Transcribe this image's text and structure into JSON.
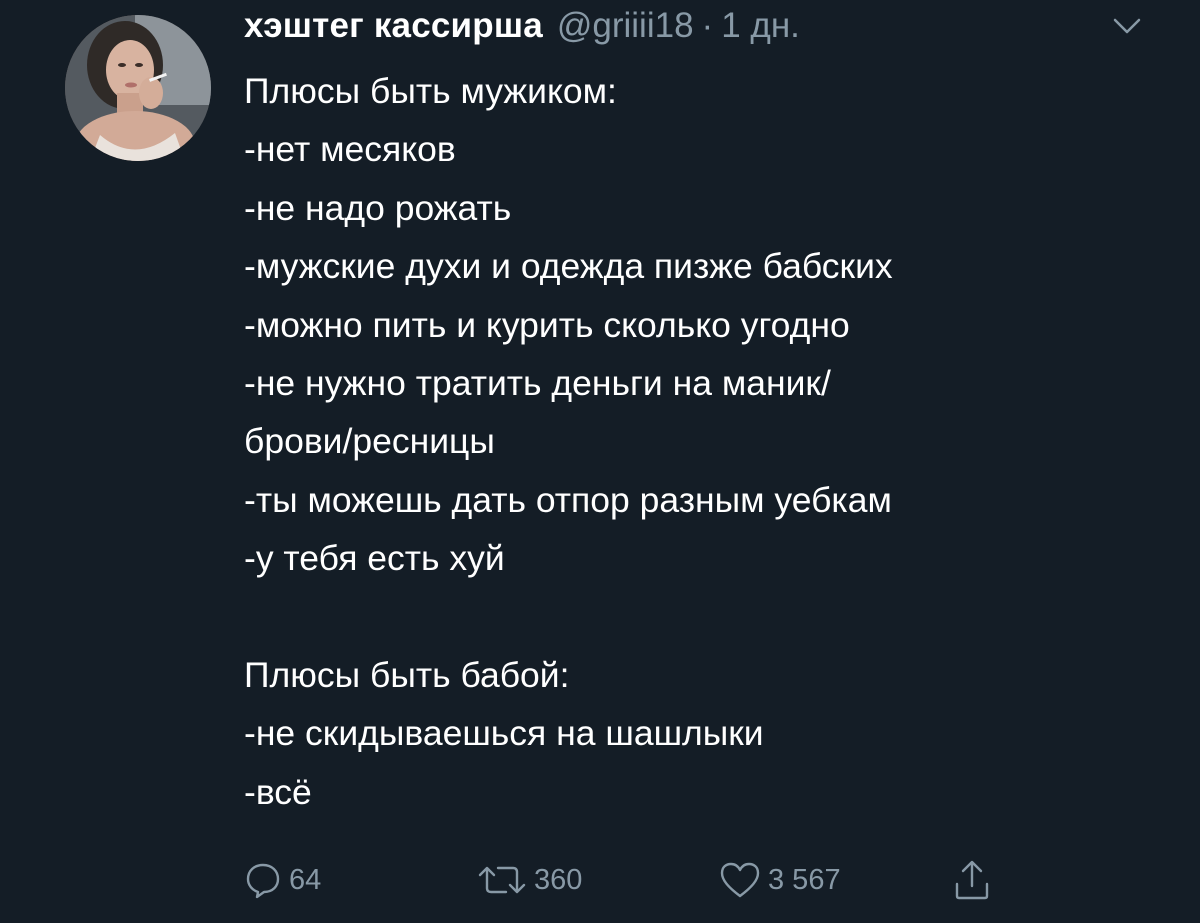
{
  "tweet": {
    "display_name": "хэштег кассирша",
    "handle": "@griiii18",
    "separator": "·",
    "time": "1 дн.",
    "lines": [
      "Плюсы быть мужиком:",
      "-нет месяков",
      "-не надо рожать",
      "-мужские духи и одежда пизже бабских",
      "-можно пить и курить сколько угодно",
      "-не нужно тратить деньги на маник/",
      "брови/ресницы",
      "-ты можешь дать отпор разным уебкам",
      "-у тебя есть хуй",
      "",
      "Плюсы быть бабой:",
      "-не скидываешься на шашлыки",
      "-всё"
    ]
  },
  "actions": {
    "reply": {
      "icon": "reply-icon",
      "count": "64"
    },
    "retweet": {
      "icon": "retweet-icon",
      "count": "360"
    },
    "like": {
      "icon": "heart-icon",
      "count": "3 567"
    },
    "share": {
      "icon": "share-icon"
    }
  },
  "menu": {
    "icon": "chevron-down-icon"
  },
  "colors": {
    "background": "#141d26",
    "text": "#ffffff",
    "secondary": "#8899a6"
  }
}
